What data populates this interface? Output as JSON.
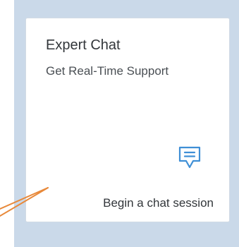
{
  "tile": {
    "title": "Expert Chat",
    "subtitle": "Get Real-Time Support",
    "footer": "Begin a chat session",
    "icon": "chat-bubble-icon"
  },
  "colors": {
    "panel_background": "#cad9e9",
    "tile_background": "#ffffff",
    "icon_accent": "#3f8fd6",
    "annotation_arrow": "#e8893a"
  }
}
